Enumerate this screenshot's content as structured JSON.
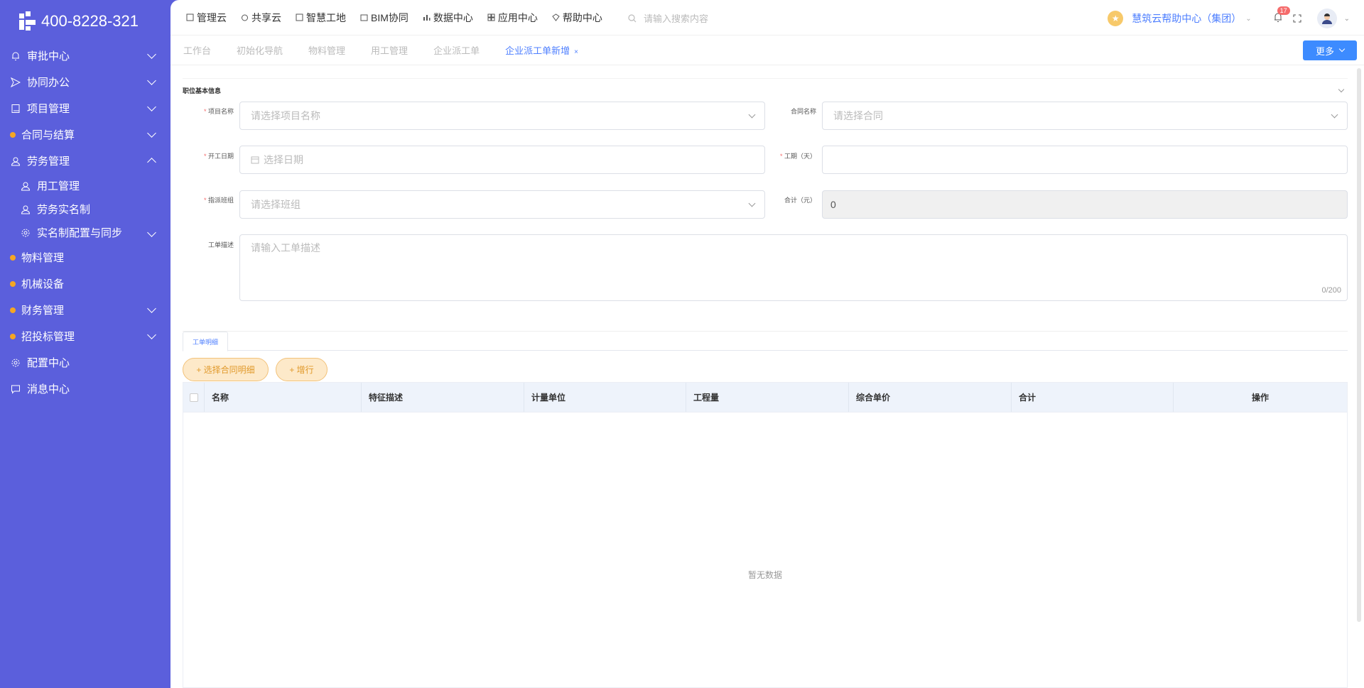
{
  "brand": {
    "phone": "400-8228-321"
  },
  "sidebar": {
    "items": [
      {
        "label": "审批中心",
        "icon": "bell-icon",
        "expanded": false
      },
      {
        "label": "协同办公",
        "icon": "send-icon",
        "expanded": false
      },
      {
        "label": "项目管理",
        "icon": "book-icon",
        "expanded": false
      },
      {
        "label": "合同与结算",
        "icon": "dot-icon",
        "expanded": false
      },
      {
        "label": "劳务管理",
        "icon": "user-icon",
        "expanded": true
      },
      {
        "label": "用工管理",
        "icon": "user-icon",
        "sub": true
      },
      {
        "label": "劳务实名制",
        "icon": "user-icon",
        "sub": true
      },
      {
        "label": "实名制配置与同步",
        "icon": "gear-icon",
        "sub": true,
        "expanded": false
      },
      {
        "label": "物料管理",
        "icon": "dot-icon"
      },
      {
        "label": "机械设备",
        "icon": "dot-icon"
      },
      {
        "label": "财务管理",
        "icon": "dot-icon",
        "expanded": false
      },
      {
        "label": "招投标管理",
        "icon": "dot-icon",
        "expanded": false
      },
      {
        "label": "配置中心",
        "icon": "gear-icon"
      },
      {
        "label": "消息中心",
        "icon": "message-icon"
      }
    ]
  },
  "topbar": {
    "links": [
      "管理云",
      "共享云",
      "智慧工地",
      "BIM协同",
      "数据中心",
      "应用中心",
      "帮助中心"
    ],
    "search_placeholder": "请输入搜索内容",
    "help_center": "慧筑云帮助中心（集团）",
    "notification_count": "17"
  },
  "tabs": {
    "items": [
      "工作台",
      "初始化导航",
      "物料管理",
      "用工管理",
      "企业派工单"
    ],
    "active": "企业派工单新增",
    "close": "×",
    "more": "更多"
  },
  "form": {
    "section_title": "职位基本信息",
    "project_label": "项目名称",
    "project_placeholder": "请选择项目名称",
    "contract_label": "合同名称",
    "contract_placeholder": "请选择合同",
    "start_label": "开工日期",
    "start_placeholder": "选择日期",
    "duration_label": "工期（天）",
    "duration_value": "",
    "team_label": "指派班组",
    "team_placeholder": "请选择班组",
    "total_label": "合计（元）",
    "total_value": "0",
    "desc_label": "工单描述",
    "desc_placeholder": "请输入工单描述",
    "desc_count": "0/200"
  },
  "detail": {
    "tab": "工单明细",
    "select_btn": "+ 选择合同明细",
    "add_btn": "+ 增行",
    "columns": [
      "名称",
      "特征描述",
      "计量单位",
      "工程量",
      "综合单价",
      "合计",
      "操作"
    ],
    "empty_text": "暂无数据"
  }
}
